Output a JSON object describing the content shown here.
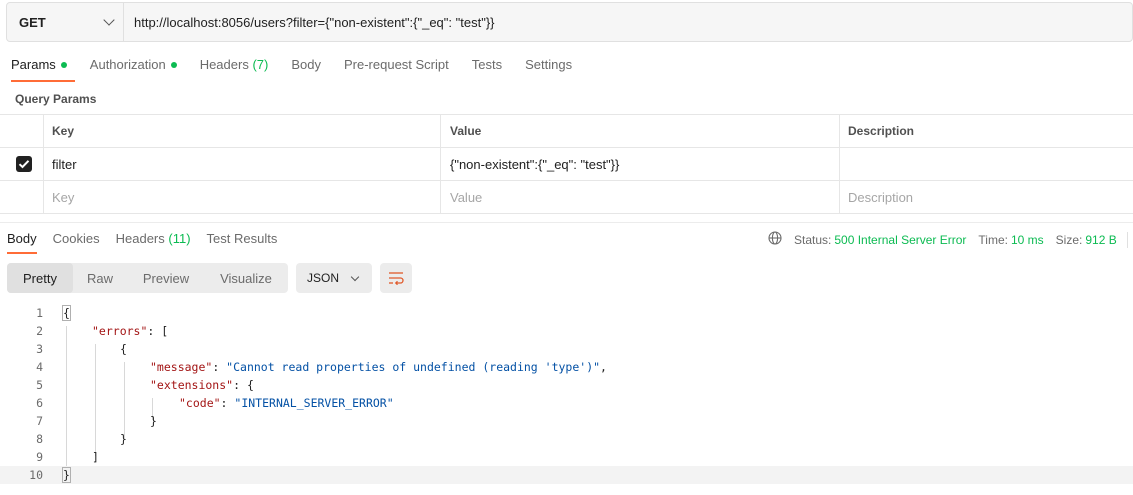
{
  "request": {
    "method": "GET",
    "url": "http://localhost:8056/users?filter={\"non-existent\":{\"_eq\": \"test\"}}"
  },
  "request_tabs": [
    {
      "label": "Params",
      "dot": true
    },
    {
      "label": "Authorization",
      "dot": true
    },
    {
      "label": "Headers",
      "count": "(7)"
    },
    {
      "label": "Body"
    },
    {
      "label": "Pre-request Script"
    },
    {
      "label": "Tests"
    },
    {
      "label": "Settings"
    }
  ],
  "query_params": {
    "title": "Query Params",
    "headers": {
      "key": "Key",
      "value": "Value",
      "description": "Description"
    },
    "rows": [
      {
        "checked": true,
        "key": "filter",
        "value": "{\"non-existent\":{\"_eq\": \"test\"}}",
        "description": ""
      }
    ],
    "placeholders": {
      "key": "Key",
      "value": "Value",
      "description": "Description"
    }
  },
  "response_tabs": [
    {
      "label": "Body"
    },
    {
      "label": "Cookies"
    },
    {
      "label": "Headers",
      "count": "(11)"
    },
    {
      "label": "Test Results"
    }
  ],
  "status": {
    "status_label": "Status:",
    "status_value": "500 Internal Server Error",
    "time_label": "Time:",
    "time_value": "10 ms",
    "size_label": "Size:",
    "size_value": "912 B"
  },
  "view_modes": [
    "Pretty",
    "Raw",
    "Preview",
    "Visualize"
  ],
  "format": "JSON",
  "code_lines": {
    "l1": "{",
    "l2_key": "\"errors\"",
    "l2_rest": ": [",
    "l3": "{",
    "l4_key": "\"message\"",
    "l4_sep": ": ",
    "l4_val": "\"Cannot read properties of undefined (reading 'type')\"",
    "l4_end": ",",
    "l5_key": "\"extensions\"",
    "l5_rest": ": {",
    "l6_key": "\"code\"",
    "l6_sep": ": ",
    "l6_val": "\"INTERNAL_SERVER_ERROR\"",
    "l7": "}",
    "l8": "}",
    "l9": "]",
    "l10": "}"
  },
  "line_numbers": [
    "1",
    "2",
    "3",
    "4",
    "5",
    "6",
    "7",
    "8",
    "9",
    "10"
  ],
  "colors": {
    "accent": "#ff6c37",
    "success": "#0cbb52"
  },
  "icons": [
    "chevron-down-icon",
    "checkbox-checked-icon",
    "globe-icon",
    "wrap-lines-icon"
  ]
}
